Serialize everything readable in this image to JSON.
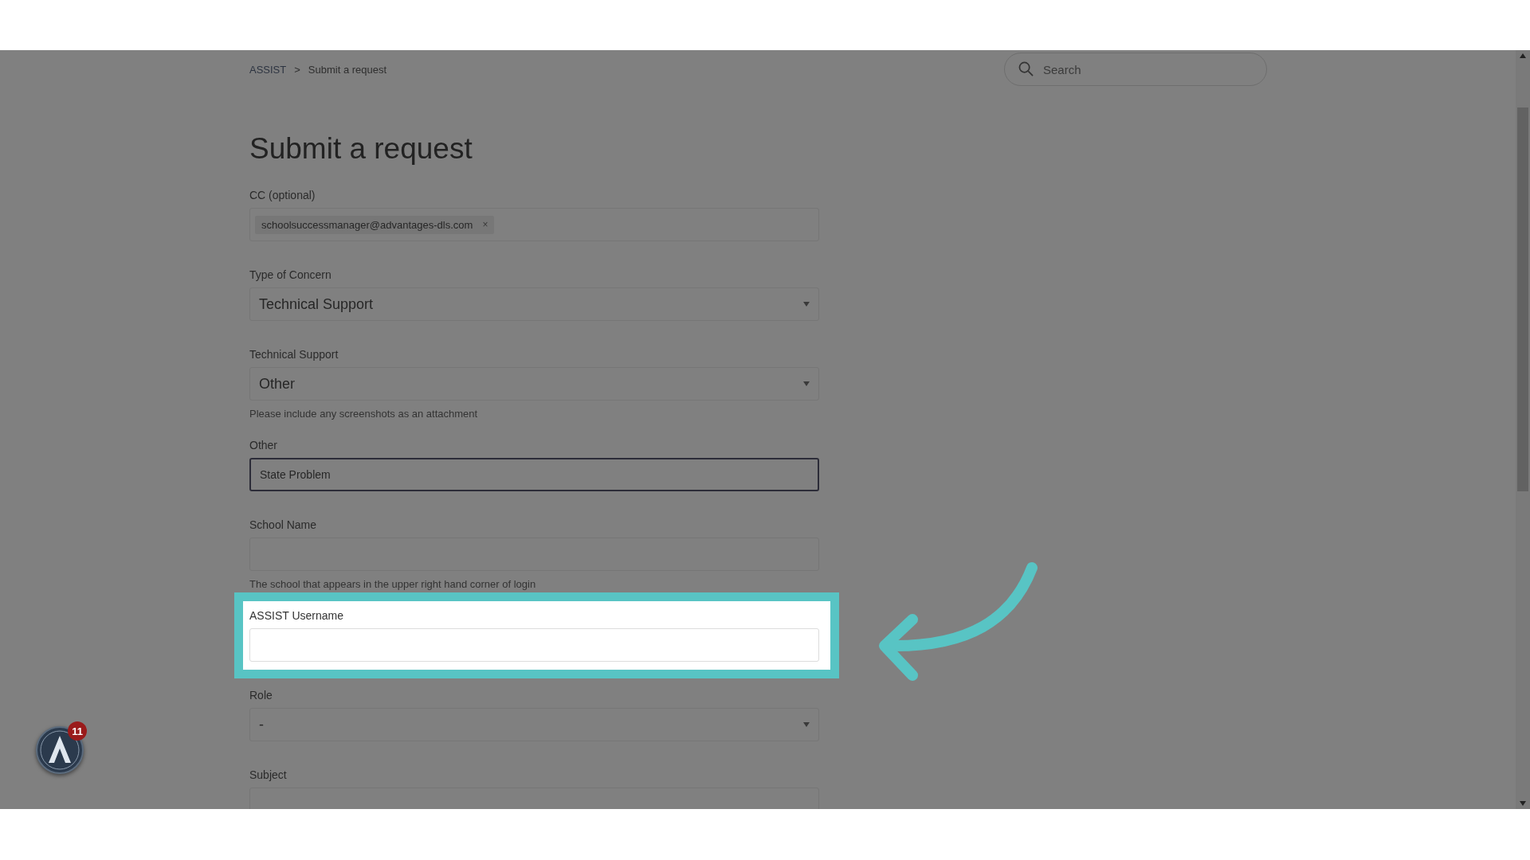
{
  "breadcrumb": [
    {
      "label": "ASSIST",
      "kind": "link"
    },
    {
      "label": ">",
      "kind": "separator"
    },
    {
      "label": "Submit a request",
      "kind": "current"
    }
  ],
  "search": {
    "placeholder": "Search"
  },
  "title": "Submit a request",
  "fields": [
    {
      "label": "CC (optional)",
      "kind": "tags",
      "tags": [
        {
          "text": "schoolsuccessmanager@advantages-dls.com",
          "remove": "×"
        }
      ],
      "focused": false,
      "highlighted": false
    },
    {
      "label": "Type of Concern",
      "kind": "select",
      "value": "Technical Support",
      "focused": false,
      "highlighted": false
    },
    {
      "label": "Technical Support",
      "kind": "select",
      "value": "Other",
      "hint": "Please include any screenshots as an attachment",
      "focused": false,
      "highlighted": false
    },
    {
      "label": "Other",
      "kind": "text",
      "value": "State Problem",
      "focused": true,
      "highlighted": false
    },
    {
      "label": "School Name",
      "kind": "text",
      "hint": "The school that appears in the upper right hand corner of login",
      "focused": false,
      "highlighted": false
    },
    {
      "label": "ASSIST Username",
      "kind": "text",
      "focused": false,
      "highlighted": true
    },
    {
      "label": "Role",
      "kind": "select",
      "value": "-",
      "focused": false,
      "highlighted": false
    },
    {
      "label": "Subject",
      "kind": "text",
      "focused": false,
      "highlighted": false
    }
  ],
  "widget": {
    "badge": "11"
  }
}
